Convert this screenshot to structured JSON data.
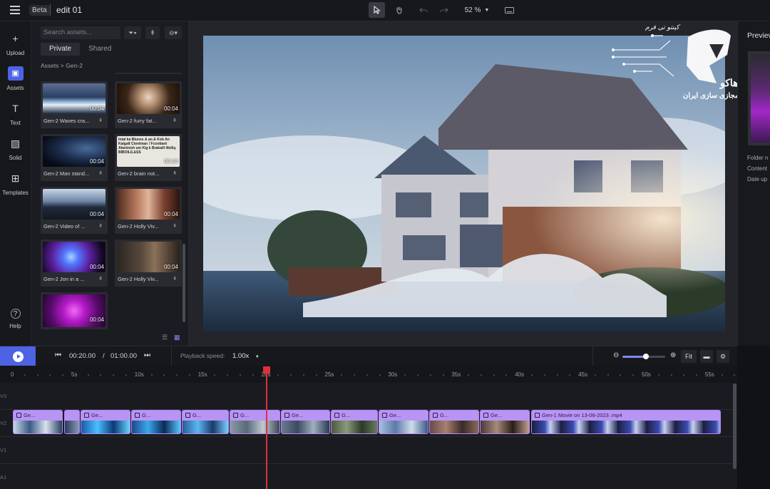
{
  "topbar": {
    "beta": "Beta",
    "title": "edit 01",
    "zoom": "52 %"
  },
  "rail": [
    {
      "label": "Upload",
      "icon": "+"
    },
    {
      "label": "Assets",
      "icon": "▣"
    },
    {
      "label": "Text",
      "icon": "T"
    },
    {
      "label": "Solid",
      "icon": "▨"
    },
    {
      "label": "Templates",
      "icon": "⊞"
    },
    {
      "label": "Help",
      "icon": "?"
    }
  ],
  "assets": {
    "search_placeholder": "Search assets...",
    "tabs": [
      "Private",
      "Shared"
    ],
    "breadcrumb": "Assets > Gen-2",
    "thumb_overlay_text": "Intal ka Btunxs & an & Kob An Kalgalt Ctentman ! Fcontiant Afantnish um Kig k Brakaill likiiliy, BIBOILIL&SS",
    "items": [
      {
        "label": "Gen-2 Waves cra...",
        "duration": "00:04"
      },
      {
        "label": "Gen-2 furry fat...",
        "duration": "00:04"
      },
      {
        "label": "Gen-2 Man stand...",
        "duration": "00:04"
      },
      {
        "label": "Gen-2 brain not...",
        "duration": "00:04"
      },
      {
        "label": "Gen-2 Video of ...",
        "duration": "00:04"
      },
      {
        "label": "Gen-2 Holly Viv...",
        "duration": "00:04"
      },
      {
        "label": "Gen-2 Jon in a ...",
        "duration": "00:04"
      },
      {
        "label": "Gen-2 Holly Viv...",
        "duration": "00:04"
      },
      {
        "label": "",
        "duration": "00:04"
      }
    ]
  },
  "logo": {
    "brand": "رهاکو",
    "tagline": "مرجع مجازی سازی ایران",
    "script": "کینتو تی فرم"
  },
  "preview": {
    "title": "Preview",
    "meta": [
      "Folder n",
      "Content",
      "Date up"
    ]
  },
  "transport": {
    "current": "00:20.00",
    "divider": "/",
    "total": "01:00.00",
    "speed_label": "Playback speed:",
    "speed_value": "1.00x",
    "zoom_level": 0.55,
    "fit": "Fit"
  },
  "ruler": {
    "labels": [
      "0",
      "5s",
      "10s",
      "15s",
      "20s",
      "25s",
      "30s",
      "35s",
      "40s",
      "45s",
      "50s",
      "55s"
    ]
  },
  "tracks": [
    "V3",
    "V2",
    "V1",
    "A1"
  ],
  "clips": [
    {
      "label": "Ge..."
    },
    {
      "label": "Ge..."
    },
    {
      "label": "G..."
    },
    {
      "label": "G..."
    },
    {
      "label": "G..."
    },
    {
      "label": "Ge..."
    },
    {
      "label": "G..."
    },
    {
      "label": "Ge..."
    },
    {
      "label": "G..."
    },
    {
      "label": "Ge..."
    },
    {
      "label": "Gen-1 Movie on 13-06-2023 .mp4"
    }
  ]
}
